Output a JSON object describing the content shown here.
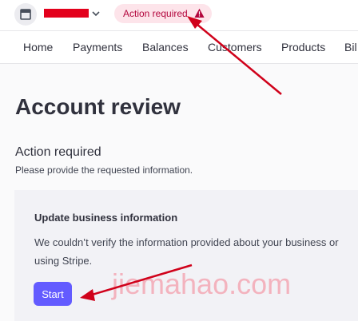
{
  "header": {
    "store_icon": "store-icon",
    "account_name_redacted": true,
    "account_switcher_icon": "chevron-down-icon",
    "status_badge": {
      "label": "Action required",
      "icon": "warning-icon",
      "color": "#b3063d",
      "background": "#fde4ea"
    }
  },
  "nav": {
    "items": [
      {
        "label": "Home"
      },
      {
        "label": "Payments"
      },
      {
        "label": "Balances"
      },
      {
        "label": "Customers"
      },
      {
        "label": "Products"
      },
      {
        "label": "Bil"
      }
    ]
  },
  "main": {
    "title": "Account review",
    "section_title": "Action required",
    "section_subtitle": "Please provide the requested information.",
    "card": {
      "title": "Update business information",
      "body_line1": "We couldn’t verify the information provided about your business or",
      "body_line2": "using Stripe.",
      "button_label": "Start"
    }
  },
  "watermark": "jiemahao.com",
  "colors": {
    "accent": "#635bff",
    "annotation_arrow": "#d0021b"
  }
}
